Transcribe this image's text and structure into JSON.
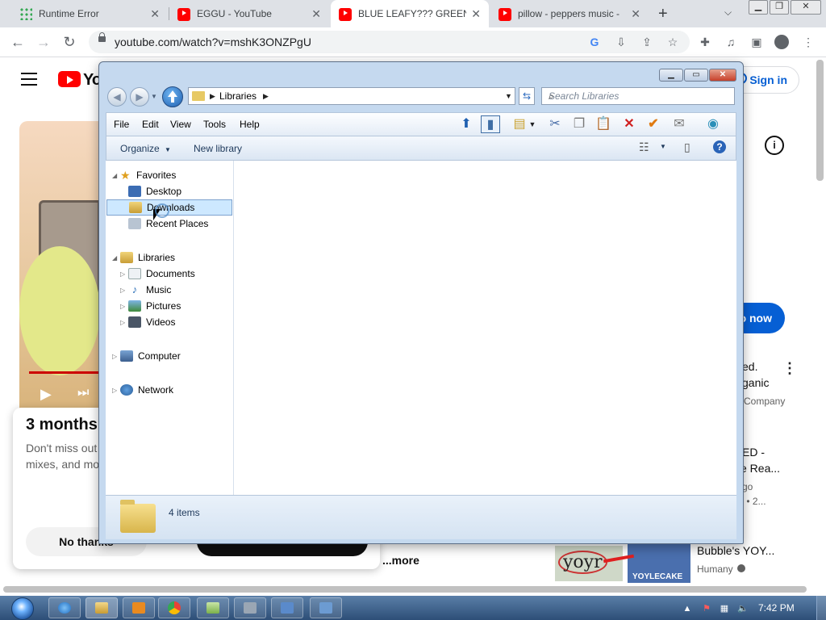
{
  "browser": {
    "tabs": [
      {
        "title": "Runtime Error",
        "icon": "puzzle-grid-icon",
        "active": false
      },
      {
        "title": "EGGU - YouTube",
        "icon": "youtube-icon",
        "active": false
      },
      {
        "title": "BLUE LEAFY??? GREEN FI",
        "icon": "youtube-icon",
        "active": true
      },
      {
        "title": "pillow - peppers music - ",
        "icon": "youtube-icon",
        "active": false
      }
    ],
    "url": "youtube.com/watch?v=mshK3ONZPgU"
  },
  "youtube": {
    "sign_in": "Sign in",
    "join_button": "o now",
    "promo_title": "3 months",
    "promo_text_1": "Don't miss out",
    "promo_text_2": "mixes, and mo",
    "promo_no_thanks": "No thanks",
    "more_link": "...more",
    "rec1_line1": "ed.",
    "rec1_line2": "ganic",
    "rec1_channel": "Company",
    "rec2_line1": "ED -",
    "rec2_line2": "e Rea...",
    "rec2_sub1": "go",
    "rec2_sub2": "s  • 2...",
    "rec3_title": "Bubble's YOY...",
    "rec3_channel": "Humany",
    "thumb_text": "yoyr",
    "thumb2_text": "YOYLECAKE"
  },
  "explorer": {
    "address": "Libraries",
    "search_placeholder": "Search Libraries",
    "menu": [
      "File",
      "Edit",
      "View",
      "Tools",
      "Help"
    ],
    "organize": "Organize",
    "new_library": "New library",
    "favorites_header": "Favorites",
    "favorites": [
      "Desktop",
      "Downloads",
      "Recent Places"
    ],
    "libraries_header": "Libraries",
    "libraries": [
      "Documents",
      "Music",
      "Pictures",
      "Videos"
    ],
    "computer": "Computer",
    "network": "Network",
    "status": "4 items"
  },
  "taskbar": {
    "clock": "7:42 PM"
  },
  "colors": {
    "youtube_red": "#ff0000",
    "link_blue": "#065fd4",
    "selection": "#cde8ff",
    "taskbar": "#2d4e77"
  }
}
